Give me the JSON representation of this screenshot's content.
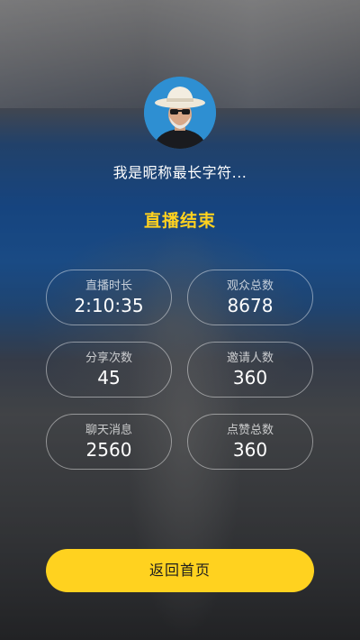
{
  "user": {
    "nickname": "我是昵称最长字符..."
  },
  "live_end_title": "直播结束",
  "stats": [
    {
      "label": "直播时长",
      "value": "2:10:35"
    },
    {
      "label": "观众总数",
      "value": "8678"
    },
    {
      "label": "分享次数",
      "value": "45"
    },
    {
      "label": "邀请人数",
      "value": "360"
    },
    {
      "label": "聊天消息",
      "value": "2560"
    },
    {
      "label": "点赞总数",
      "value": "360"
    }
  ],
  "home_button_label": "返回首页",
  "colors": {
    "accent": "#ffd21f"
  }
}
